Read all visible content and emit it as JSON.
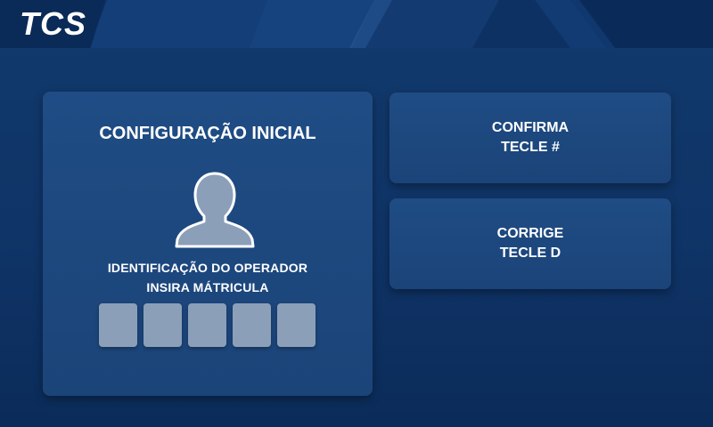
{
  "header": {
    "logo_text": "TCS"
  },
  "main": {
    "title": "CONFIGURAÇÃO INICIAL",
    "avatar_icon": "user-silhouette-icon",
    "subtitle_line1": "IDENTIFICAÇÃO DO OPERADOR",
    "subtitle_line2": "INSIRA MÁTRICULA",
    "digit_count": 5
  },
  "actions": {
    "confirm": {
      "line1": "CONFIRMA",
      "line2": "TECLE #"
    },
    "correct": {
      "line1": "CORRIGE",
      "line2": "TECLE D"
    }
  },
  "colors": {
    "background": "#0f3467",
    "card": "#1f4c84",
    "digit_box": "#8c9fb8",
    "avatar_fill": "#8c9fb8",
    "text": "#ffffff"
  }
}
